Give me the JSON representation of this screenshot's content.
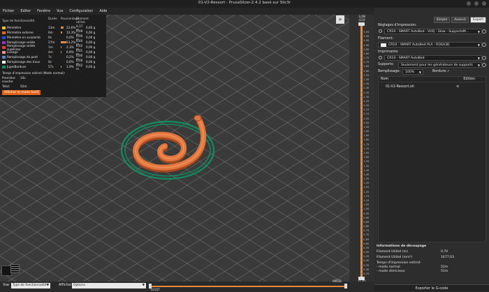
{
  "window": {
    "title": "01-V2-Ressort - PrusaSlicer-2.4.2 basé sur Slic3r"
  },
  "menu": [
    "Fichier",
    "Editer",
    "Fenêtre",
    "Vue",
    "Configuration",
    "Aide"
  ],
  "legend": {
    "headers": {
      "type": "Type de fonctionnalité",
      "time": "Durée",
      "pct": "Pourcentage",
      "used": "Filament utilisé"
    },
    "rows": [
      {
        "name": "Périmètre",
        "time": "13m",
        "pct": "22,6%",
        "len": "0,17 m",
        "wt": "0,00 g",
        "color": "#f0c23b",
        "bar": 0.45
      },
      {
        "name": "Périmètre externe",
        "time": "6m",
        "pct": "12,3%",
        "len": "0,09 m",
        "wt": "0,00 g",
        "color": "#e16a21",
        "bar": 0.25
      },
      {
        "name": "Périmètre en surplomb",
        "time": "0s",
        "pct": "0,0%",
        "len": "0,00 m",
        "wt": "0,00 g",
        "color": "#1f4dd1",
        "bar": 0
      },
      {
        "name": "Remplissage solide",
        "time": "27m",
        "pct": "53,2%",
        "len": "0,40 m",
        "wt": "0,00 g",
        "color": "#9b2fc7",
        "bar": 1.0
      },
      {
        "name": "Remplissage solide supérieur",
        "time": "1m",
        "pct": "2,3%",
        "len": "0,02 m",
        "wt": "0,00 g",
        "color": "#e23b3b",
        "bar": 0.05
      },
      {
        "name": "Lissage",
        "time": "4m",
        "pct": "6,9%",
        "len": "0,01 m",
        "wt": "0,00 g",
        "color": "#e89090",
        "bar": 0.13
      },
      {
        "name": "Remplissage du pont",
        "time": "7s",
        "pct": "0,2%",
        "len": "0,00 m",
        "wt": "0,00 g",
        "color": "#5c84c9",
        "bar": 0
      },
      {
        "name": "Remplissage des trous",
        "time": "0s",
        "pct": "0,0%",
        "len": "0,00 m",
        "wt": "0,00 g",
        "color": "#ffffff",
        "bar": 0
      },
      {
        "name": "Jupe/Bordure",
        "time": "57s",
        "pct": "1,9%",
        "len": "0,02 m",
        "wt": "0,00 g",
        "color": "#138a5e",
        "bar": 0.04
      }
    ],
    "estimated_title": "Temps d'impression estimé (Mode normal):",
    "first_layer_label": "Première couche:",
    "first_layer_value": "10s",
    "total_label": "Total:",
    "total_value": "52m",
    "hide_button": "Afficher le mode furtif"
  },
  "layer_slider": {
    "top_value": "3,08",
    "top_layer": "(23)",
    "bottom_value": "0,20",
    "bottom_layer": "(1)",
    "ticks": [
      "3,05",
      "3,00",
      "2,95",
      "2,90",
      "2,85",
      "2,80",
      "2,75",
      "2,70",
      "2,65",
      "2,60",
      "2,55",
      "2,50",
      "2,45",
      "2,40",
      "2,35",
      "2,30",
      "2,25",
      "2,20",
      "2,15",
      "2,10",
      "2,05",
      "2,00",
      "1,95",
      "1,90",
      "1,85",
      "1,80",
      "1,75",
      "1,70",
      "1,65",
      "1,60",
      "1,55",
      "1,50",
      "1,45",
      "1,40",
      "1,35",
      "1,30",
      "1,25",
      "1,20",
      "1,15",
      "1,10",
      "1,05",
      "1,00",
      "0,95",
      "0,90",
      "0,85",
      "0,80",
      "0,75",
      "0,70",
      "0,65",
      "0,60",
      "0,55",
      "0,50",
      "0,45",
      "0,40",
      "0,35",
      "0,30",
      "0,25"
    ]
  },
  "sidebar": {
    "tabs": [
      "Simple",
      "Avancé",
      "Expert"
    ],
    "print_settings_label": "Réglages d'impression:",
    "print_settings_value": "CR10 - SMART AutoBed - VHQ - Slow - SupportsM...",
    "filament_label": "Filament:",
    "filament_value": "CR10 - SMART AutoBed PLA - ROSA3D",
    "filament_color": "#f4f4f4",
    "printer_label": "Imprimante:",
    "printer_value": "CR10 - SMART AutoBed",
    "supports_label": "Supports:",
    "supports_value": "Seulement pour les générateurs de supports",
    "infill_label": "Remplissage:",
    "infill_value": "100%",
    "brim_label": "Bordure:",
    "brim_check": "✓",
    "objects_header_name": "Nom",
    "objects_header_edit": "Edition",
    "objects": [
      {
        "name": "01-V2-Ressort.stl"
      }
    ],
    "slice_info_title": "Informations de découpage",
    "slice_info": [
      {
        "k": "Filament Utilisé (m)",
        "v": "0,70"
      },
      {
        "k": "Filament Utilisé (mm³)",
        "v": "1677,03"
      }
    ],
    "estimated_title": "Temps d'impression estimé:",
    "modes": [
      {
        "k": "- mode normal",
        "v": "52m"
      },
      {
        "k": "- mode silencieux",
        "v": "51m"
      }
    ],
    "export_button": "Exporter le G-code"
  },
  "bottombar": {
    "view_label": "Vue",
    "view_value": "Type de fonctionnalité",
    "show_label": "Afficher",
    "show_value": "Options",
    "slider_left_value": "02107",
    "slider_right_value": "00033"
  },
  "colors": {
    "accent": "#e58b3b",
    "skirt": "#138a5e",
    "part": "#e0763e"
  }
}
